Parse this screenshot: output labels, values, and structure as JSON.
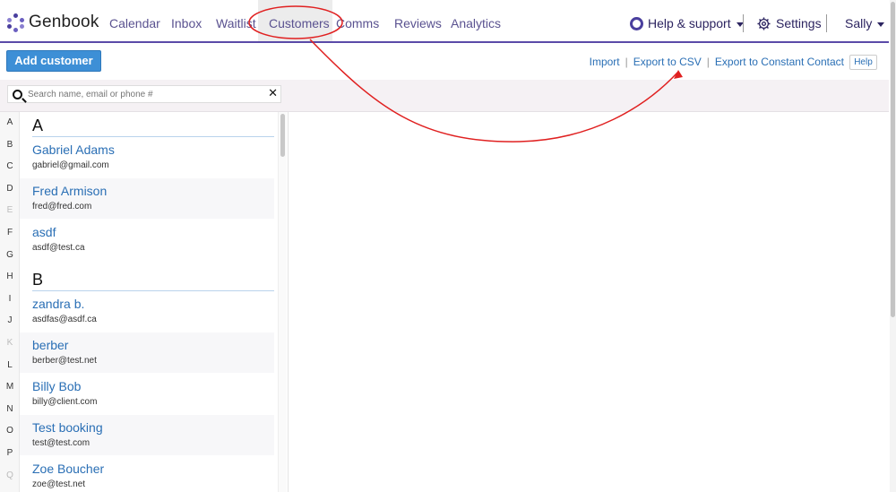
{
  "app": {
    "logo_text": "Genbook"
  },
  "nav": {
    "items": [
      "Calendar",
      "Inbox",
      "Waitlist",
      "Customers",
      "Comms",
      "Reviews",
      "Analytics"
    ],
    "active": "Customers",
    "help_support": "Help & support",
    "settings": "Settings",
    "user": "Sally"
  },
  "toolbar": {
    "add_customer": "Add customer",
    "import": "Import",
    "export_csv": "Export to CSV",
    "export_cc": "Export to Constant Contact",
    "separator": "|",
    "help": "Help"
  },
  "search": {
    "placeholder": "Search name, email or phone #",
    "clear": "✕"
  },
  "alphabet": [
    {
      "letter": "A",
      "enabled": true
    },
    {
      "letter": "B",
      "enabled": true
    },
    {
      "letter": "C",
      "enabled": true
    },
    {
      "letter": "D",
      "enabled": true
    },
    {
      "letter": "E",
      "enabled": false
    },
    {
      "letter": "F",
      "enabled": true
    },
    {
      "letter": "G",
      "enabled": true
    },
    {
      "letter": "H",
      "enabled": true
    },
    {
      "letter": "I",
      "enabled": true
    },
    {
      "letter": "J",
      "enabled": true
    },
    {
      "letter": "K",
      "enabled": false
    },
    {
      "letter": "L",
      "enabled": true
    },
    {
      "letter": "M",
      "enabled": true
    },
    {
      "letter": "N",
      "enabled": true
    },
    {
      "letter": "O",
      "enabled": true
    },
    {
      "letter": "P",
      "enabled": true
    },
    {
      "letter": "Q",
      "enabled": false
    }
  ],
  "customers": {
    "sections": [
      {
        "letter": "A",
        "items": [
          {
            "name": "Gabriel Adams",
            "email": "gabriel@gmail.com"
          },
          {
            "name": "Fred Armison",
            "email": "fred@fred.com"
          },
          {
            "name": "asdf",
            "email": "asdf@test.ca"
          }
        ]
      },
      {
        "letter": "B",
        "items": [
          {
            "name": "zandra b.",
            "email": "asdfas@asdf.ca"
          },
          {
            "name": "berber",
            "email": "berber@test.net"
          },
          {
            "name": "Billy Bob",
            "email": "billy@client.com"
          },
          {
            "name": "Test booking",
            "email": "test@test.com"
          },
          {
            "name": "Zoe Boucher",
            "email": "zoe@test.net"
          }
        ]
      }
    ]
  },
  "annotation": {
    "color": "#e02020"
  }
}
